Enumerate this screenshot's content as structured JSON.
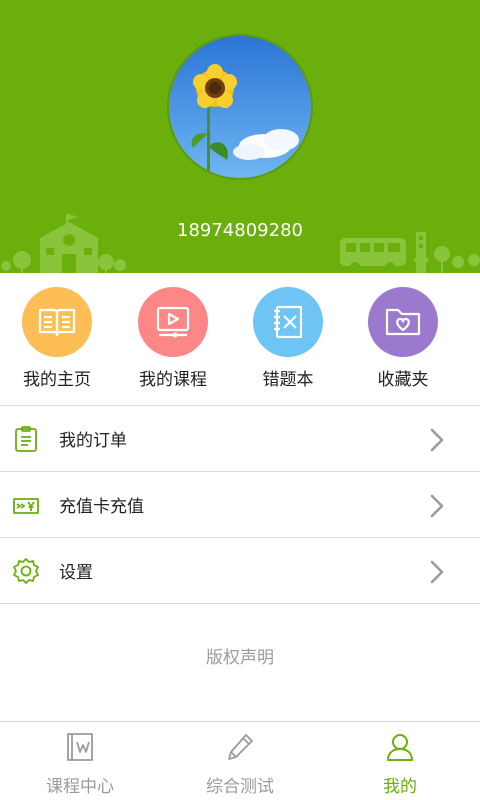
{
  "colors": {
    "brand_green": "#6aaf0c",
    "light_green": "#89c43a",
    "text_gray": "#9b9b9b"
  },
  "profile": {
    "phone": "18974809280"
  },
  "quick_menu": [
    {
      "label": "我的主页",
      "icon": "book-icon",
      "color": "#fdbf55"
    },
    {
      "label": "我的课程",
      "icon": "video-play-icon",
      "color": "#fd8787"
    },
    {
      "label": "错题本",
      "icon": "error-note-icon",
      "color": "#6ec5f5"
    },
    {
      "label": "收藏夹",
      "icon": "heart-folder-icon",
      "color": "#9a79cf"
    }
  ],
  "menu_list": [
    {
      "label": "我的订单",
      "icon": "order-list-icon"
    },
    {
      "label": "充值卡充值",
      "icon": "recharge-card-icon"
    },
    {
      "label": "设置",
      "icon": "gear-icon"
    }
  ],
  "footer": {
    "copyright": "版权声明"
  },
  "tabs": [
    {
      "label": "课程中心",
      "icon": "course-book-icon",
      "active": false
    },
    {
      "label": "综合测试",
      "icon": "pencil-icon",
      "active": false
    },
    {
      "label": "我的",
      "icon": "user-icon",
      "active": true
    }
  ]
}
